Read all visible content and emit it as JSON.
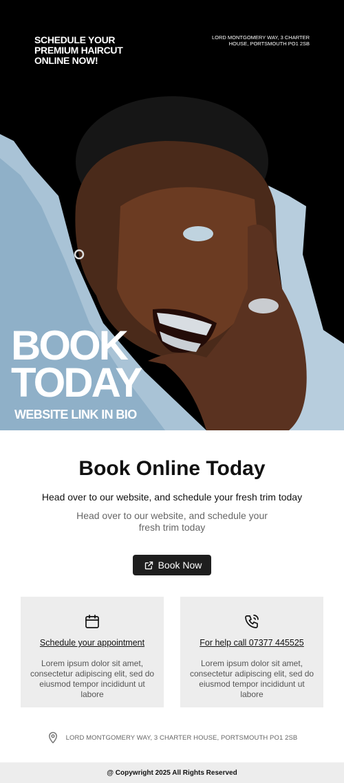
{
  "hero": {
    "tagline": "SCHEDULE YOUR PREMIUM HAIRCUT ONLINE NOW!",
    "address": "LORD MONTGOMERY WAY, 3 CHARTER HOUSE, PORTSMOUTH PO1 2SB",
    "big_line1": "BOOK",
    "big_line2": "TODAY",
    "sub": "WEBSITE LINK IN BIO"
  },
  "main": {
    "title": "Book Online Today",
    "lead": "Head over to our website, and schedule your fresh trim today",
    "lead_secondary": "Head over to our website, and schedule your fresh trim today",
    "button_label": "Book Now",
    "button_icon": "external-link-icon"
  },
  "cards": [
    {
      "icon": "calendar-icon",
      "link": "Schedule your appointment",
      "text": "Lorem ipsum dolor sit amet, consectetur adipiscing elit, sed do eiusmod tempor incididunt ut labore"
    },
    {
      "icon": "phone-icon",
      "link": "For help call 07377 445525",
      "text": "Lorem ipsum dolor sit amet, consectetur adipiscing elit, sed do eiusmod tempor incididunt ut labore"
    }
  ],
  "address_row": {
    "icon": "map-pin-icon",
    "text": "LORD MONTGOMERY WAY, 3 CHARTER HOUSE, PORTSMOUTH PO1 2SB"
  },
  "footer": {
    "text": "@ Copywright 2025 All Rights Reserved"
  },
  "colors": {
    "hero_bg": "#000000",
    "button_bg": "#1e1e1e",
    "card_bg": "#ededed",
    "jacket": "#a9c3d6"
  }
}
